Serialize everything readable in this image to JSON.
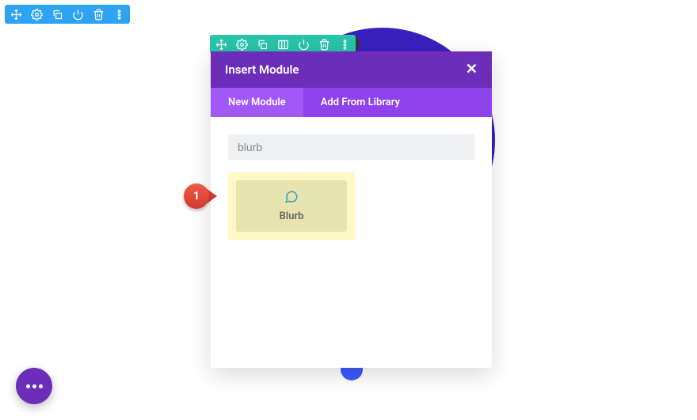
{
  "section_toolbar": {
    "icons": [
      "move",
      "settings",
      "duplicate",
      "power",
      "delete",
      "more"
    ]
  },
  "row_toolbar": {
    "icons": [
      "move",
      "settings",
      "duplicate",
      "columns",
      "power",
      "delete",
      "more"
    ]
  },
  "modal": {
    "title": "Insert Module",
    "tabs": {
      "new_module": "New Module",
      "add_library": "Add From Library"
    },
    "search_value": "blurb",
    "module": {
      "label": "Blurb"
    }
  },
  "callout": {
    "number": "1"
  }
}
